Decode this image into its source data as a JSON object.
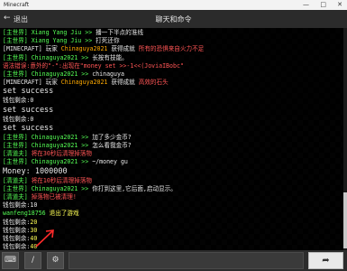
{
  "window": {
    "title": "Minecraft"
  },
  "header": {
    "back_icon": "left-arrow-icon",
    "back_label": "退出",
    "title": "聊天和命令"
  },
  "colors": {
    "green": "#55ff55",
    "gold": "#ffaa00",
    "red": "#ff5555",
    "aqua": "#55ffff",
    "white": "#e8e8e8",
    "yellow": "#ffff55"
  },
  "lines": [
    [
      {
        "t": "[主世界]",
        "c": "#55ff55"
      },
      {
        "t": " Xiang Yang Jiu >> ",
        "c": "#55ff55"
      },
      {
        "t": "播一下半点的准线",
        "c": "#e8e8e8"
      }
    ],
    [
      {
        "t": "[主世界]",
        "c": "#55ff55"
      },
      {
        "t": " Xiang Yang Jiu >> ",
        "c": "#55ff55"
      },
      {
        "t": "打死还你",
        "c": "#e8e8e8"
      }
    ],
    [
      {
        "t": "[MINECRAFT] 玩家 ",
        "c": "#e8e8e8"
      },
      {
        "t": "Chinaguya2021 ",
        "c": "#ffaa00"
      },
      {
        "t": "获得成就 ",
        "c": "#e8e8e8"
      },
      {
        "t": "所有的恐惧来自火力不足",
        "c": "#ff5555"
      }
    ],
    [
      {
        "t": "[主世界]",
        "c": "#55ff55"
      },
      {
        "t": " Chinaguya2021 >> ",
        "c": "#55ff55"
      },
      {
        "t": "长按有技能。",
        "c": "#e8e8e8"
      }
    ],
    [
      {
        "t": "语法错误:意外的\"-\":出现在\"money set >>-1<<(JoviaIBobc\"",
        "c": "#ff5555"
      }
    ],
    [
      {
        "t": "[主世界]",
        "c": "#55ff55"
      },
      {
        "t": " Chinaguya2021 >> ",
        "c": "#55ff55"
      },
      {
        "t": "chinaguya",
        "c": "#e8e8e8"
      }
    ],
    [
      {
        "t": "[MINECRAFT] 玩家 ",
        "c": "#e8e8e8"
      },
      {
        "t": "Chinaguya2021 ",
        "c": "#ffaa00"
      },
      {
        "t": "获得成就 ",
        "c": "#e8e8e8"
      },
      {
        "t": "高效的石头",
        "c": "#ff5555"
      }
    ],
    [
      {
        "t": "set success",
        "c": "#e8e8e8",
        "big": true
      }
    ],
    [
      {
        "t": "钱包剩余:0",
        "c": "#e8e8e8"
      }
    ],
    [
      {
        "t": "set success",
        "c": "#e8e8e8",
        "big": true
      }
    ],
    [
      {
        "t": "钱包剩余:0",
        "c": "#e8e8e8"
      }
    ],
    [
      {
        "t": "set success",
        "c": "#e8e8e8",
        "big": true
      }
    ],
    [
      {
        "t": "[主世界]",
        "c": "#55ff55"
      },
      {
        "t": " Chinaguya2021 >> ",
        "c": "#55ff55"
      },
      {
        "t": "加了多少金币?",
        "c": "#e8e8e8"
      }
    ],
    [
      {
        "t": "[主世界]",
        "c": "#55ff55"
      },
      {
        "t": " Chinaguya2021 >> ",
        "c": "#55ff55"
      },
      {
        "t": "怎么看我金币?",
        "c": "#e8e8e8"
      }
    ],
    [
      {
        "t": "[清道夫] ",
        "c": "#55ff55"
      },
      {
        "t": "将在30秒后清理掉落物",
        "c": "#ff5555"
      }
    ],
    [
      {
        "t": "[主世界]",
        "c": "#55ff55"
      },
      {
        "t": " Chinaguya2021 >> ",
        "c": "#55ff55"
      },
      {
        "t": "~/money gu",
        "c": "#e8e8e8"
      }
    ],
    [
      {
        "t": "Money: 1000000",
        "c": "#e8e8e8",
        "big": true
      }
    ],
    [
      {
        "t": "[清道夫] ",
        "c": "#55ff55"
      },
      {
        "t": "将在10秒后清理掉落物",
        "c": "#ff5555"
      }
    ],
    [
      {
        "t": "[主世界]",
        "c": "#55ff55"
      },
      {
        "t": " Chinaguya2021 >> ",
        "c": "#55ff55"
      },
      {
        "t": "你打到这里,它后面,启动显示。",
        "c": "#e8e8e8"
      }
    ],
    [
      {
        "t": "[清道夫] ",
        "c": "#55ff55"
      },
      {
        "t": "掉落物已被清理!",
        "c": "#ff5555"
      }
    ],
    [
      {
        "t": "钱包剩余:10",
        "c": "#e8e8e8"
      }
    ],
    [
      {
        "t": "wanfeng18756 ",
        "c": "#55ff55"
      },
      {
        "t": "退出了游戏",
        "c": "#ffff55"
      }
    ],
    [
      {
        "t": "钱包剩余:",
        "c": "#e8e8e8"
      },
      {
        "t": "20",
        "c": "#ffff55"
      }
    ],
    [
      {
        "t": "钱包剩余:",
        "c": "#e8e8e8"
      },
      {
        "t": "30",
        "c": "#ffff55"
      }
    ],
    [
      {
        "t": "钱包剩余:",
        "c": "#e8e8e8"
      },
      {
        "t": "40",
        "c": "#ffff55"
      }
    ],
    [
      {
        "t": "钱包剩余:",
        "c": "#e8e8e8"
      },
      {
        "t": "40",
        "c": "#ffff55"
      }
    ]
  ],
  "bottom": {
    "keyboard_icon": "keyboard-icon",
    "slash_label": "/",
    "settings_icon": "gear-icon",
    "input_placeholder": "",
    "send_icon": "send-icon"
  }
}
